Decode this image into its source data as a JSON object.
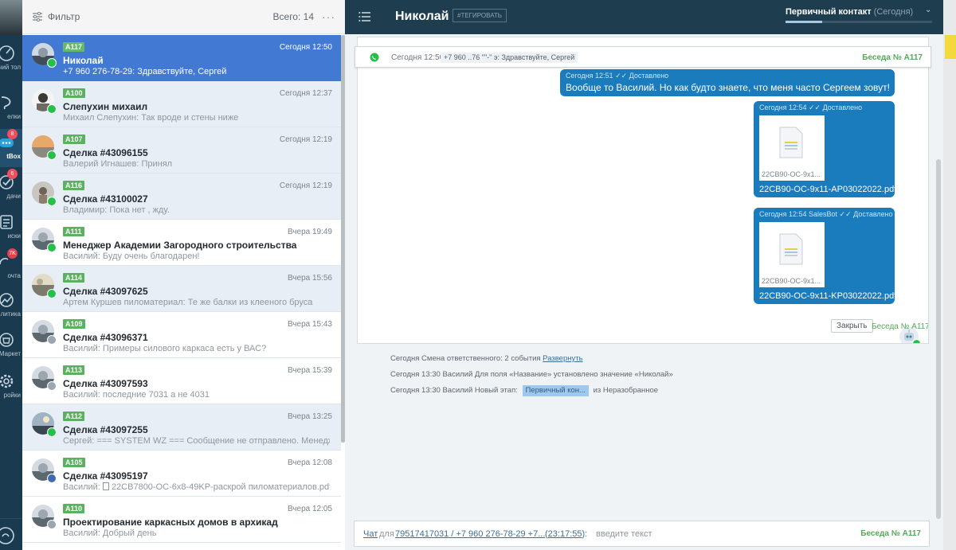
{
  "nav": {
    "items": [
      {
        "label": "бочий тол",
        "badge": ""
      },
      {
        "label": "елки",
        "badge": ""
      },
      {
        "label": "tBox",
        "badge": "8"
      },
      {
        "label": "дачи",
        "badge": "6"
      },
      {
        "label": "иски",
        "badge": ""
      },
      {
        "label": "очта",
        "badge": "7K"
      },
      {
        "label": "литика",
        "badge": ""
      },
      {
        "label": "Маркет",
        "badge": ""
      },
      {
        "label": "ройки",
        "badge": ""
      }
    ]
  },
  "list": {
    "filter_label": "Фильтр",
    "total_label": "Всего: 14",
    "more": "···",
    "conversations": [
      {
        "tag": "A117",
        "title": "Николай",
        "preview": "+7 960 276-78-29: Здравствуйте, Сергей",
        "time": "Сегодня 12:50",
        "channel": "whatsapp"
      },
      {
        "tag": "A100",
        "title": "Слепухин михаил",
        "preview": "Михаил Слепухин: Так вроде и стены ниже",
        "time": "Сегодня 12:37",
        "channel": "whatsapp"
      },
      {
        "tag": "A107",
        "title": "Сделка #43096155",
        "preview": "Валерий Игнашев: Принял",
        "time": "Сегодня 12:19",
        "channel": "whatsapp"
      },
      {
        "tag": "A116",
        "title": "Сделка #43100027",
        "preview": "Владимир: Пока нет , жду.",
        "time": "Сегодня 12:19",
        "channel": "whatsapp"
      },
      {
        "tag": "A111",
        "title": "Менеджер Академии Загородного строительства",
        "preview": "Василий: Буду очень благодарен!",
        "time": "Вчера 19:49",
        "channel": "whatsapp"
      },
      {
        "tag": "A114",
        "title": "Сделка #43097625",
        "preview": "Артем Куршев пиломатериал: Те же балки из клееного бруса",
        "time": "Вчера 15:56",
        "channel": "whatsapp"
      },
      {
        "tag": "A109",
        "title": "Сделка #43096371",
        "preview": "Василий: Примеры силового каркаса есть у ВАС?",
        "time": "Вчера 15:43",
        "channel": "gear"
      },
      {
        "tag": "A113",
        "title": "Сделка #43097593",
        "preview": "Василий: последние 7031 а не 4031",
        "time": "Вчера 15:39",
        "channel": "gear"
      },
      {
        "tag": "A112",
        "title": "Сделка #43097255",
        "preview": "Сергей: === SYSTEM WZ === Сообщение не отправлено. Менеджера с",
        "time": "Вчера 13:25",
        "channel": "whatsapp"
      },
      {
        "tag": "A105",
        "title": "Сделка #43095197",
        "preview_prefix": "Василий:",
        "preview": "22CB7800-OC-6x8-49KP-раскрой пиломатериалов.pdf",
        "time": "Вчера 12:08",
        "channel": "vk"
      },
      {
        "tag": "A110",
        "title": "Проектирование каркасных домов в архикад",
        "preview": "Василий: Добрый день",
        "time": "Вчера 12:05",
        "channel": "gear"
      }
    ]
  },
  "chat": {
    "name": "Николай",
    "tag_button": "#ТЕГИРОВАТЬ",
    "stage_name": "Первичный контакт",
    "stage_date": "(Сегодня)",
    "stage_progress": 0.25,
    "thread_header": {
      "date": "Сегодня 12:50",
      "chip": "+7 960 ..76 \"\"-\" э: Здравствуйте, Сергей",
      "conversation": "Беседа № A117"
    },
    "messages": [
      {
        "meta": "Сегодня 12:51 ✓✓ Доставлено",
        "text": "Вообще то Василий. Но как будто знаете, что меня часто Сергеем зовут!"
      },
      {
        "meta": "Сегодня 12:54 ✓✓ Доставлено",
        "thumb_name": "22CB90-OC-9x1...",
        "file": "22CB90-OC-9x11-AP03022022.pdf"
      },
      {
        "meta": "Сегодня 12:54 SalesBot ✓✓ Доставлено",
        "thumb_name": "22CB90-OC-9x1...",
        "file": "22CB90-OC-9x11-KP03022022.pdf"
      }
    ],
    "close_button": "Закрыть",
    "conversation_ref": "Беседа № A117",
    "events": [
      {
        "text": "Сегодня Смена ответственного: 2 события",
        "link": "Развернуть"
      },
      {
        "text": "Сегодня 13:30 Василий Для поля «Название» установлено значение «Николай»"
      },
      {
        "text": "Сегодня 13:30 Василий Новый этап:",
        "chip": "Первичный кон...",
        "suffix": "из Неразобранное"
      }
    ],
    "composer": {
      "chat_link": "Чат",
      "for_label": "для",
      "phones": "79517417031 / +7 960 276-78-29 +7...",
      "time": "23:17:55",
      "time_prefix": "(",
      "time_suffix": "):",
      "placeholder": "введите текст",
      "conversation": "Беседа № A117"
    }
  },
  "colors": {
    "selected_row": "#4279d3",
    "shaded_row": "#e8eef6",
    "tag_green": "#5bb15f",
    "bubble_blue": "#1a7bbd",
    "header_dark": "#1e3d4f",
    "whatsapp_green": "#25c04a"
  },
  "icons": [
    "filter-icon",
    "more-icon",
    "menu-icon",
    "chevron-down-icon",
    "whatsapp-icon",
    "pdf-file-icon",
    "bot-avatar",
    "read-check-icon"
  ]
}
